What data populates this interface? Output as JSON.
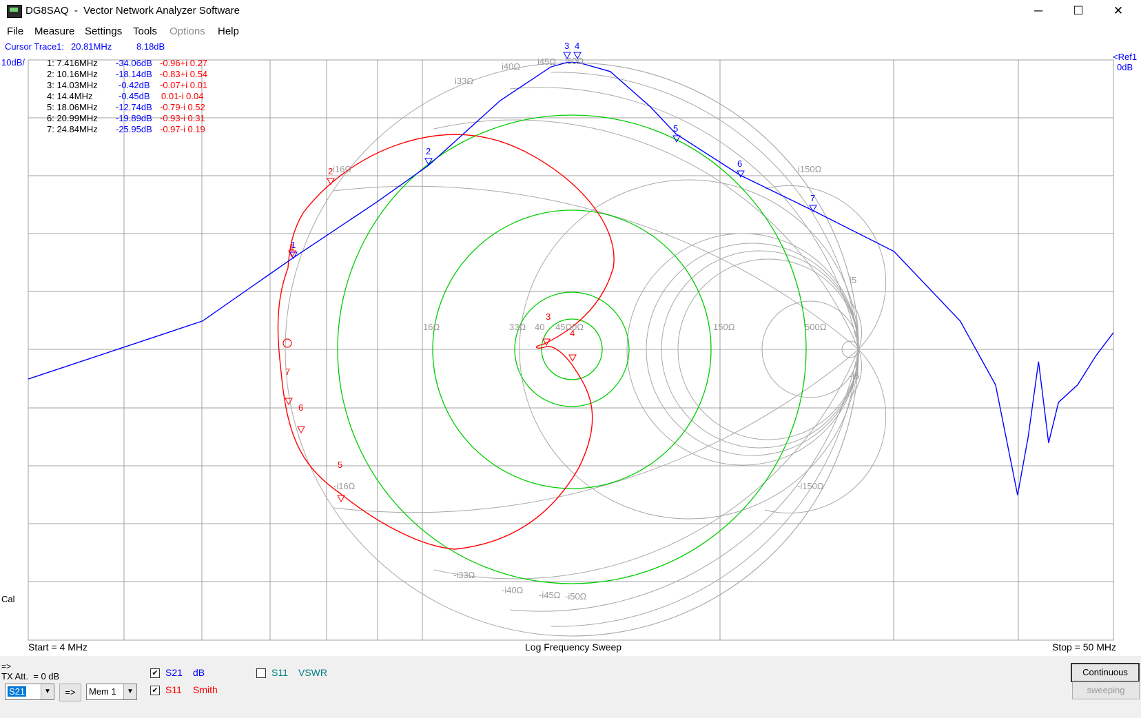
{
  "window": {
    "title": "DG8SAQ  -  Vector Network Analyzer Software",
    "minimize": "─",
    "maximize": "☐",
    "close": "✕"
  },
  "menu": [
    "File",
    "Measure",
    "Settings",
    "Tools",
    "Options",
    "Help"
  ],
  "cursor_readout": {
    "label": "Cursor Trace1:",
    "freq": "20.81MHz",
    "value": "8.18dB"
  },
  "scale": {
    "left": "10dB/",
    "right_ref": "<Ref1",
    "right_db": "0dB",
    "cal": "Cal"
  },
  "markers": [
    {
      "freq": "1: 7.416MHz",
      "db": "-34.06dB",
      "z": "-0.96+i 0.27"
    },
    {
      "freq": "2: 10.16MHz",
      "db": "-18.14dB",
      "z": "-0.83+i 0.54"
    },
    {
      "freq": "3: 14.03MHz",
      "db": "-0.42dB",
      "z": "-0.07+i 0.01"
    },
    {
      "freq": "4: 14.4MHz",
      "db": "-0.45dB",
      "z": "0.01-i 0.04"
    },
    {
      "freq": "5: 18.06MHz",
      "db": "-12.74dB",
      "z": "-0.79-i 0.52"
    },
    {
      "freq": "6: 20.99MHz",
      "db": "-19.89dB",
      "z": "-0.93-i 0.31"
    },
    {
      "freq": "7: 24.84MHz",
      "db": "-25.95dB",
      "z": "-0.97-i 0.19"
    }
  ],
  "smith_labels": {
    "r16": "16Ω",
    "r33": "33Ω",
    "r40": "40",
    "r45": "45Ω",
    "r50": "0Ω",
    "r150": "150Ω",
    "r500": "500Ω",
    "xp16": "i16Ω",
    "xp33": "i33Ω",
    "xp40": "i40Ω",
    "xp45": "i45Ω",
    "xp50": "i50Ω",
    "xp150": "i150Ω",
    "xp500": "i5",
    "xn16": "-i16Ω",
    "xn33": "-i33Ω",
    "xn40": "-i40Ω",
    "xn45": "-i45Ω",
    "xn50": "-i50Ω",
    "xn150": "-i150Ω",
    "xn500": "-i5"
  },
  "axis": {
    "start": "Start = 4 MHz",
    "center": "Log Frequency Sweep",
    "stop": "Stop = 50 MHz"
  },
  "marker_nums": {
    "m1": "1",
    "m2": "2",
    "m3": "3",
    "m4": "4",
    "m5": "5",
    "m6": "6",
    "m7": "7"
  },
  "bottom": {
    "arrow": "=>",
    "tx_att": "TX Att.  = 0 dB",
    "trace_select": "S21",
    "transfer_btn": "=>",
    "mem_select": "Mem 1",
    "trace1_name": "S21",
    "trace1_fmt": "dB",
    "trace2_name": "S11",
    "trace2_fmt": "Smith",
    "trace3_name": "S11",
    "trace3_fmt": "VSWR",
    "continuous_btn": "Continuous",
    "sweeping_btn": "sweeping"
  },
  "colors": {
    "trace_s21": "#0000ff",
    "trace_s11": "#ff0000",
    "vswr_circles": "#00cc00",
    "grid": "#a0a0a0"
  },
  "chart_data": {
    "type": "line",
    "x_scale": "log",
    "xlim_mhz": [
      4,
      50
    ],
    "ylabel": "10dB/",
    "series": [
      {
        "name": "S21",
        "unit": "dB",
        "x": [
          4,
          5,
          6,
          7.416,
          9,
          10.16,
          12,
          13.5,
          14.03,
          14.4,
          15.5,
          17,
          18.06,
          20.99,
          24.84,
          30,
          35,
          38,
          40,
          41,
          42,
          43,
          44,
          46,
          48,
          50
        ],
        "y": [
          -55,
          -49.5,
          -45,
          -34.06,
          -24.5,
          -18.14,
          -7,
          -1.2,
          -0.42,
          -0.45,
          -2,
          -8,
          -12.74,
          -19.89,
          -25.95,
          -33,
          -45,
          -56,
          -75,
          -65,
          -52,
          -66,
          -59,
          -56,
          -51,
          -47
        ]
      },
      {
        "name": "S11",
        "unit": "Smith"
      }
    ]
  }
}
